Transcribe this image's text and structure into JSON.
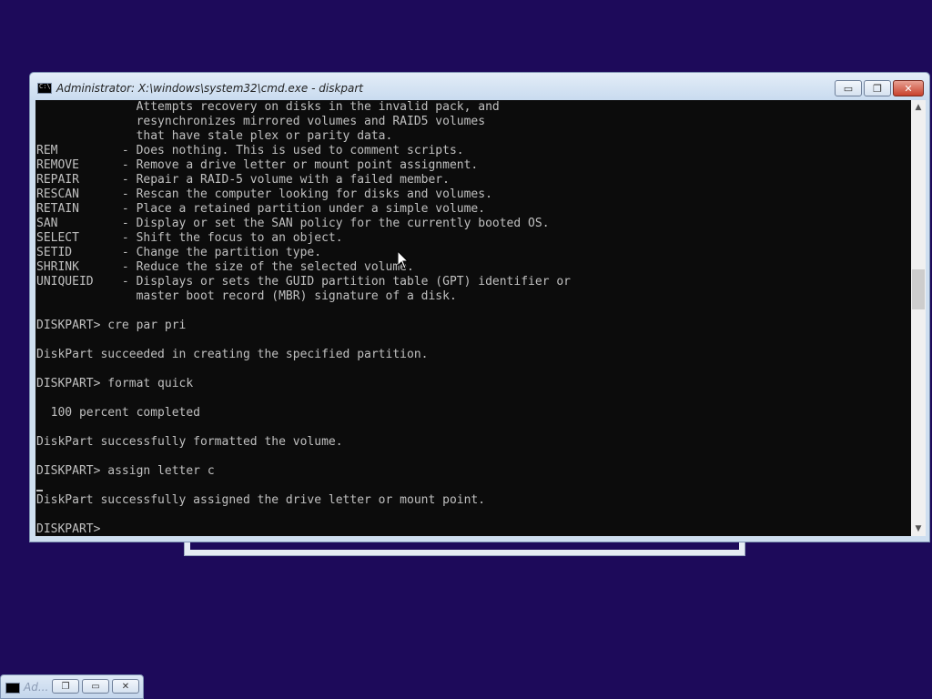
{
  "window": {
    "title": "Administrator: X:\\windows\\system32\\cmd.exe - diskpart",
    "minimize_glyph": "▭",
    "maximize_glyph": "❐",
    "close_glyph": "✕"
  },
  "console": {
    "lines": [
      "              Attempts recovery on disks in the invalid pack, and",
      "              resynchronizes mirrored volumes and RAID5 volumes",
      "              that have stale plex or parity data.",
      "REM         - Does nothing. This is used to comment scripts.",
      "REMOVE      - Remove a drive letter or mount point assignment.",
      "REPAIR      - Repair a RAID-5 volume with a failed member.",
      "RESCAN      - Rescan the computer looking for disks and volumes.",
      "RETAIN      - Place a retained partition under a simple volume.",
      "SAN         - Display or set the SAN policy for the currently booted OS.",
      "SELECT      - Shift the focus to an object.",
      "SETID       - Change the partition type.",
      "SHRINK      - Reduce the size of the selected volume.",
      "UNIQUEID    - Displays or sets the GUID partition table (GPT) identifier or",
      "              master boot record (MBR) signature of a disk.",
      "",
      "DISKPART> cre par pri",
      "",
      "DiskPart succeeded in creating the specified partition.",
      "",
      "DISKPART> format quick",
      "",
      "  100 percent completed",
      "",
      "DiskPart successfully formatted the volume.",
      "",
      "DISKPART> assign letter c",
      "",
      "DiskPart successfully assigned the drive letter or mount point.",
      "",
      "DISKPART> "
    ]
  },
  "scrollbar": {
    "up_arrow": "▲",
    "down_arrow": "▼"
  },
  "taskbar": {
    "label": "Ad..."
  },
  "colors": {
    "desktop_bg": "#1d0a5a",
    "console_bg": "#0c0c0c",
    "console_fg": "#c0c0c0",
    "close_button": "#c8412c"
  }
}
